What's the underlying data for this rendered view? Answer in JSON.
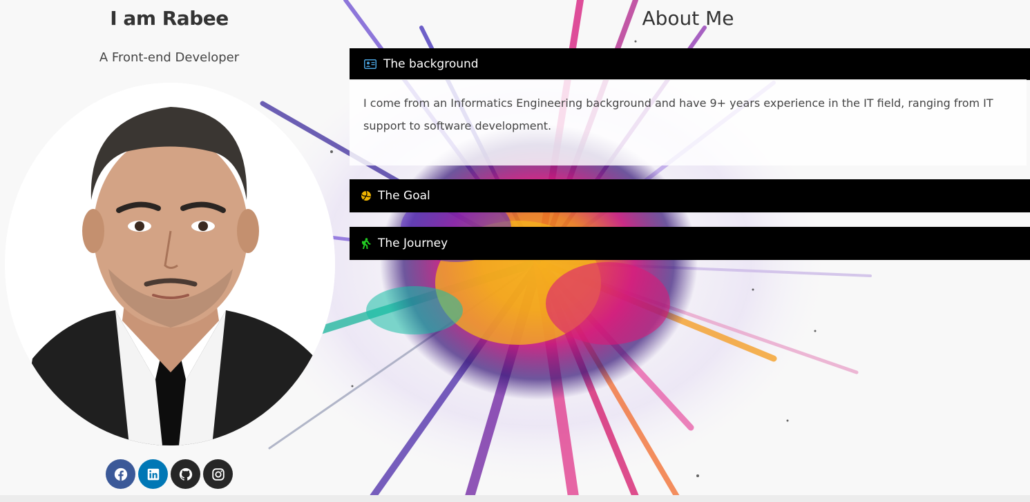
{
  "profile": {
    "name": "I am Rabee",
    "role": "A Front-end Developer"
  },
  "social": [
    {
      "icon": "facebook-icon",
      "color": "#3b5998"
    },
    {
      "icon": "linkedin-icon",
      "color": "#0077b5"
    },
    {
      "icon": "github-icon",
      "color": "#262626"
    },
    {
      "icon": "instagram-icon",
      "color": "#262626"
    }
  ],
  "about": {
    "title": "About Me",
    "sections": [
      {
        "title": "The background",
        "icon": "id-card-icon",
        "icon_color": "#4aa3df",
        "expanded": true,
        "content": "I come from an Informatics Engineering background and have 9+ years experience in the IT field, ranging from IT support to software development."
      },
      {
        "title": "The Goal",
        "icon": "volleyball-icon",
        "icon_color": "#f0b400",
        "expanded": false
      },
      {
        "title": "The Journey",
        "icon": "hiking-icon",
        "icon_color": "#22cc22",
        "expanded": false
      }
    ]
  },
  "colors": {
    "accordion_header_bg": "#000000",
    "page_bg": "#f8f8f8"
  }
}
